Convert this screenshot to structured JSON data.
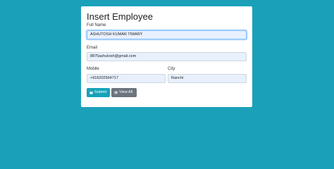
{
  "form": {
    "title": "Insert Employee",
    "full_name_label": "Full Name",
    "full_name_value": "ASHUTOSH KUMAR TIWARY",
    "email_label": "Email",
    "email_value": "8875ashutosh@gmail.com",
    "mobile_label": "Mobile",
    "mobile_value": "+916202564717",
    "city_label": "City",
    "city_value": "Ranchi"
  },
  "buttons": {
    "submit_label": "Submit",
    "submit_icon": "save-icon",
    "view_all_label": "View All",
    "view_all_icon": "table-icon"
  },
  "colors": {
    "background": "#1aa1b9",
    "submit": "#17a2b8",
    "view_all": "#6c757d"
  }
}
